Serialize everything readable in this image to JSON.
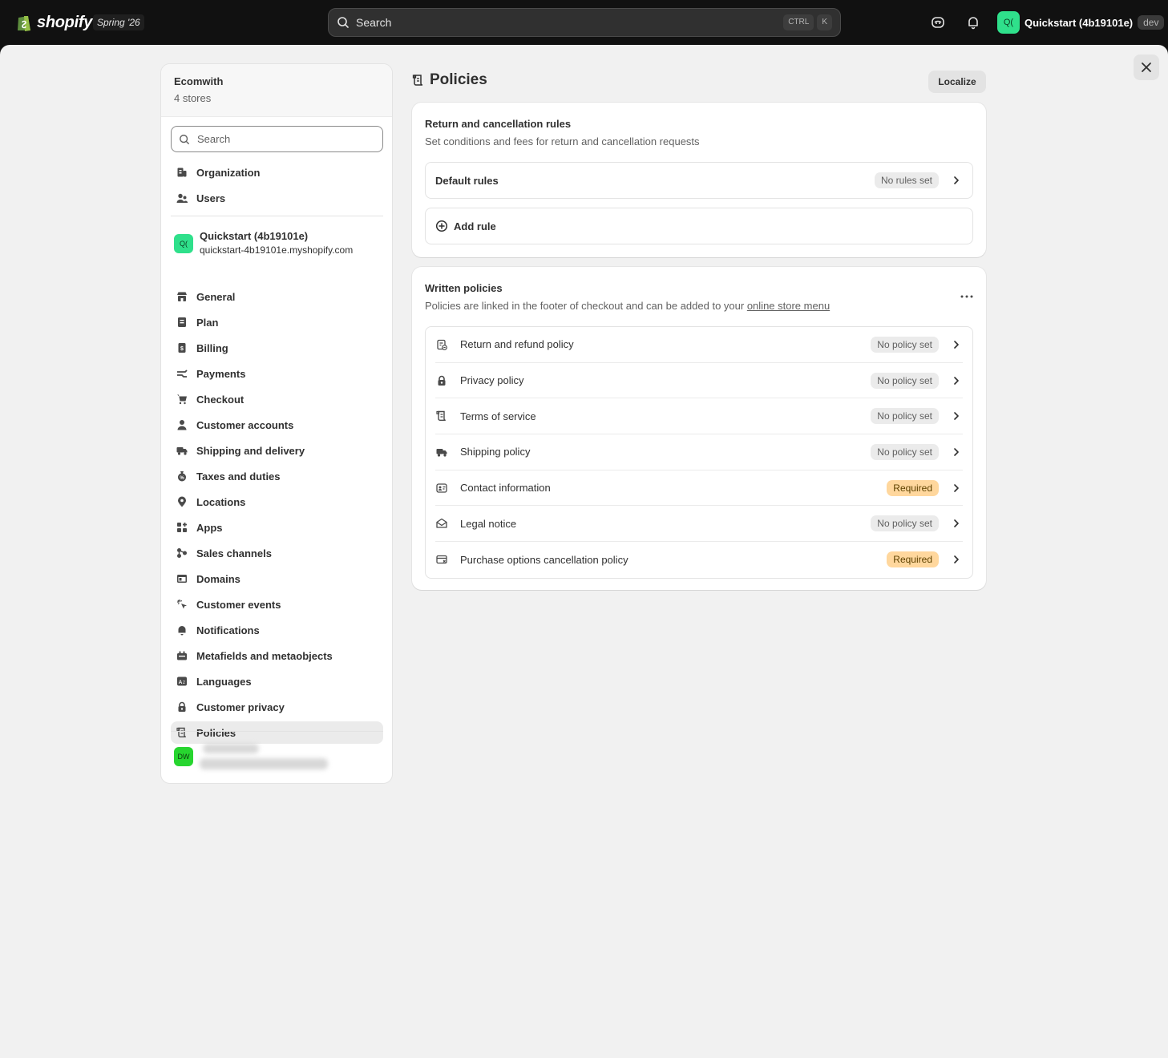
{
  "topbar": {
    "logo_text": "shopify",
    "release": "Spring '26",
    "search_placeholder": "Search",
    "kbd_ctrl": "CTRL",
    "kbd_k": "K",
    "store_initials": "Q(",
    "store_name": "Quickstart (4b19101e)",
    "env_badge": "dev"
  },
  "sidebar": {
    "org_name": "Ecomwith",
    "org_sub": "4 stores",
    "search_placeholder": "Search",
    "top_items": [
      {
        "label": "Organization",
        "icon": "organization-icon"
      },
      {
        "label": "Users",
        "icon": "users-icon"
      }
    ],
    "store": {
      "initials": "Q(",
      "name": "Quickstart (4b19101e)",
      "url": "quickstart-4b19101e.myshopify.com"
    },
    "items": [
      {
        "label": "General",
        "icon": "store-icon"
      },
      {
        "label": "Plan",
        "icon": "plan-icon"
      },
      {
        "label": "Billing",
        "icon": "billing-icon"
      },
      {
        "label": "Payments",
        "icon": "payments-icon"
      },
      {
        "label": "Checkout",
        "icon": "cart-icon"
      },
      {
        "label": "Customer accounts",
        "icon": "person-icon"
      },
      {
        "label": "Shipping and delivery",
        "icon": "truck-icon"
      },
      {
        "label": "Taxes and duties",
        "icon": "tax-icon"
      },
      {
        "label": "Locations",
        "icon": "location-icon"
      },
      {
        "label": "Apps",
        "icon": "apps-icon"
      },
      {
        "label": "Sales channels",
        "icon": "channels-icon"
      },
      {
        "label": "Domains",
        "icon": "domains-icon"
      },
      {
        "label": "Customer events",
        "icon": "events-icon"
      },
      {
        "label": "Notifications",
        "icon": "bell-icon"
      },
      {
        "label": "Metafields and metaobjects",
        "icon": "metafields-icon"
      },
      {
        "label": "Languages",
        "icon": "language-icon"
      },
      {
        "label": "Customer privacy",
        "icon": "lock-icon"
      },
      {
        "label": "Policies",
        "icon": "policies-icon",
        "active": true
      }
    ],
    "other_store_initials": "DW"
  },
  "page": {
    "title": "Policies",
    "localize_label": "Localize"
  },
  "return_card": {
    "title": "Return and cancellation rules",
    "description": "Set conditions and fees for return and cancellation requests",
    "default_rules_label": "Default rules",
    "default_rules_badge": "No rules set",
    "add_rule_label": "Add rule"
  },
  "written_card": {
    "title": "Written policies",
    "description_prefix": "Policies are linked in the footer of checkout and can be added to your ",
    "description_link": "online store menu",
    "policies": [
      {
        "label": "Return and refund policy",
        "badge": "No policy set",
        "status": "none",
        "icon": "refund-icon"
      },
      {
        "label": "Privacy policy",
        "badge": "No policy set",
        "status": "none",
        "icon": "lock-icon"
      },
      {
        "label": "Terms of service",
        "badge": "No policy set",
        "status": "none",
        "icon": "policies-icon"
      },
      {
        "label": "Shipping policy",
        "badge": "No policy set",
        "status": "none",
        "icon": "truck-icon"
      },
      {
        "label": "Contact information",
        "badge": "Required",
        "status": "required",
        "icon": "contact-card-icon"
      },
      {
        "label": "Legal notice",
        "badge": "No policy set",
        "status": "none",
        "icon": "envelope-icon"
      },
      {
        "label": "Purchase options cancellation policy",
        "badge": "Required",
        "status": "required",
        "icon": "card-cancel-icon"
      }
    ]
  },
  "colors": {
    "topbar_bg": "#111111",
    "main_bg": "#f1f1f1",
    "store_avatar": "#2fe08b",
    "required_badge": "#ffd79d",
    "neutral_badge": "#ebebeb"
  }
}
